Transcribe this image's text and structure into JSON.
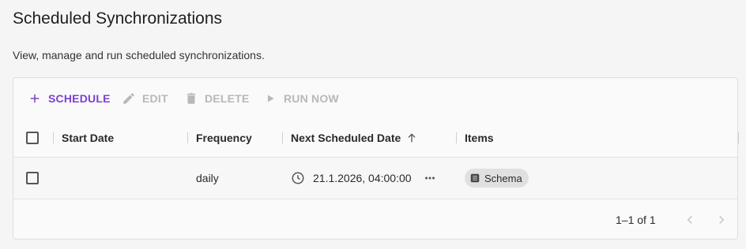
{
  "page": {
    "title": "Scheduled Synchronizations",
    "subtitle": "View, manage and run scheduled synchronizations."
  },
  "toolbar": {
    "schedule_label": "SCHEDULE",
    "edit_label": "EDIT",
    "delete_label": "DELETE",
    "run_now_label": "RUN NOW"
  },
  "table": {
    "columns": [
      "Start Date",
      "Frequency",
      "Next Scheduled Date",
      "Items"
    ],
    "sort": {
      "column": "Next Scheduled Date",
      "direction": "asc"
    },
    "rows": [
      {
        "start_date": "",
        "frequency": "daily",
        "next_scheduled_date": "21.1.2026, 04:00:00",
        "items": [
          "Schema"
        ]
      }
    ]
  },
  "pagination": {
    "range_text": "1–1 of 1"
  },
  "colors": {
    "accent": "#7e3fd0",
    "disabled": "#b8b8b8"
  },
  "icons": {
    "schedule": "plus-icon",
    "edit": "pencil-icon",
    "delete": "trash-icon",
    "run_now": "play-icon",
    "sort": "arrow-up-icon",
    "time": "clock-icon",
    "more": "more-horizontal-icon",
    "chip": "list-icon",
    "prev": "chevron-left-icon",
    "next": "chevron-right-icon"
  }
}
